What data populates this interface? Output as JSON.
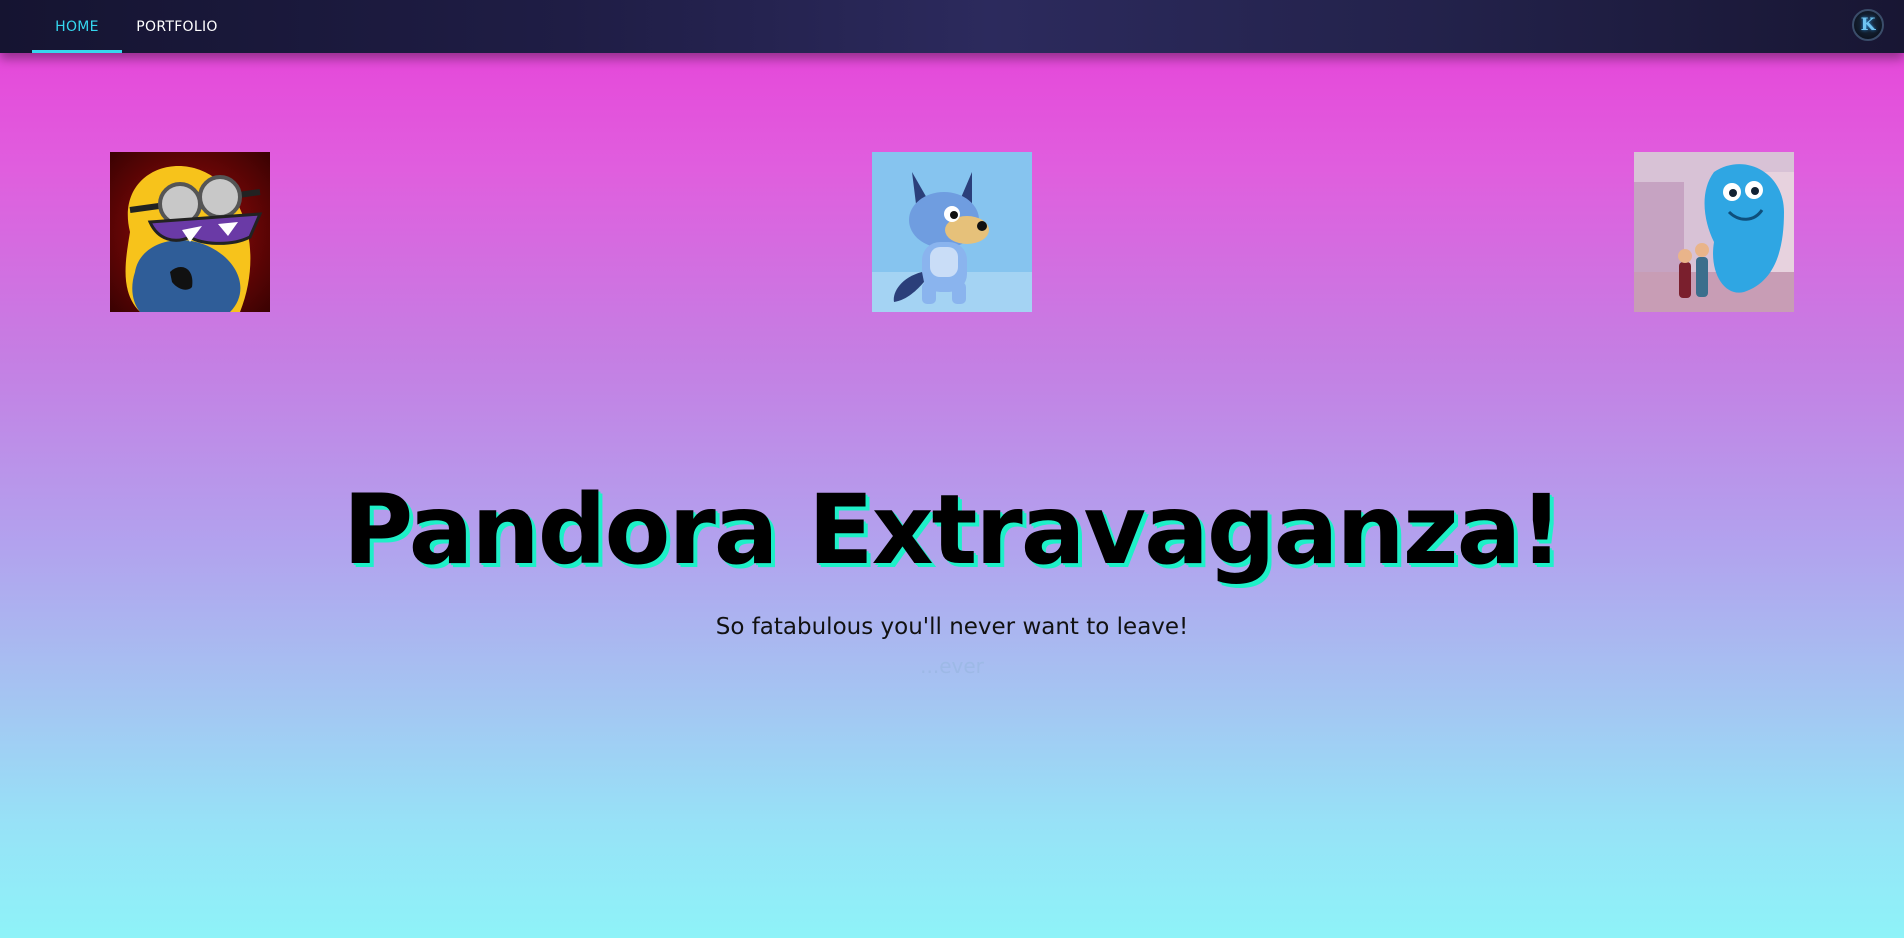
{
  "nav": {
    "tabs": [
      {
        "label": "HOME",
        "active": true
      },
      {
        "label": "PORTFOLIO",
        "active": false
      }
    ],
    "logo_letter": "K",
    "accent_color": "#35d6ee"
  },
  "gallery": [
    {
      "subject": "minion character with goggles"
    },
    {
      "subject": "bluey cartoon dog"
    },
    {
      "subject": "blue monster in city street"
    }
  ],
  "hero": {
    "title": "Pandora Extravaganza!",
    "subtitle": "So fatabulous you'll never want to leave!",
    "tagline": "...ever"
  },
  "colors": {
    "background_top": "#e83fd8",
    "background_bottom": "#8ef3f8",
    "title_shadow": "#1ef0c8",
    "navbar": "#1f1d45"
  }
}
